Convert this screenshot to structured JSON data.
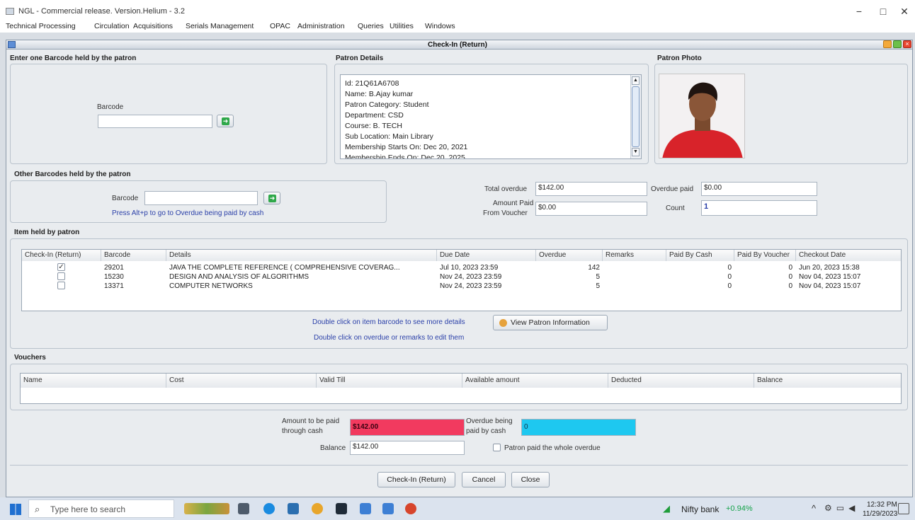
{
  "window": {
    "title": "NGL - Commercial release. Version.Helium - 3.2",
    "minimize": "−",
    "maximize": "□",
    "close": "✕"
  },
  "menu": [
    "Technical Processing",
    "Circulation",
    "Acquisitions",
    "Serials Management",
    "OPAC",
    "Administration",
    "Queries",
    "Utilities",
    "Windows"
  ],
  "frame": {
    "title": "Check-In (Return)"
  },
  "barcode_section": {
    "title": "Enter one Barcode held by the patron",
    "label": "Barcode",
    "value": ""
  },
  "patron_details": {
    "title": "Patron Details",
    "lines": [
      "Id: 21Q61A6708",
      "Name: B.Ajay kumar",
      "Patron Category: Student",
      "Department: CSD",
      "Course: B. TECH",
      "Sub Location: Main Library",
      "Membership Starts On: Dec 20, 2021",
      "Membership Ends On: Dec 20, 2025"
    ]
  },
  "patron_photo": {
    "title": "Patron Photo"
  },
  "other_barcodes": {
    "title": "Other Barcodes held by the patron",
    "label": "Barcode",
    "value": "",
    "hint": "Press Alt+p to go to Overdue being paid by cash"
  },
  "summary": {
    "total_overdue_label": "Total overdue",
    "total_overdue": "$142.00",
    "overdue_paid_label": "Overdue paid",
    "overdue_paid": "$0.00",
    "amount_voucher_label_1": "Amount Paid",
    "amount_voucher_label_2": "From Voucher",
    "amount_voucher": "$0.00",
    "count_label": "Count",
    "count": "1"
  },
  "items": {
    "title": "Item held by patron",
    "columns": [
      "Check-In (Return)",
      "Barcode",
      "Details",
      "Due Date",
      "Overdue",
      "Remarks",
      "Paid By Cash",
      "Paid By Voucher",
      "Checkout Date"
    ],
    "rows": [
      {
        "checked": true,
        "barcode": "29201",
        "details": "JAVA THE COMPLETE REFERENCE ( COMPREHENSIVE COVERAG...",
        "due": "Jul 10, 2023 23:59",
        "overdue": "142",
        "remarks": "",
        "cash": "0",
        "voucher": "0",
        "checkout": "Jun 20, 2023 15:38"
      },
      {
        "checked": false,
        "barcode": "15230",
        "details": "DESIGN AND ANALYSIS OF ALGORITHMS",
        "due": "Nov 24, 2023 23:59",
        "overdue": "5",
        "remarks": "",
        "cash": "0",
        "voucher": "0",
        "checkout": "Nov 04, 2023 15:07"
      },
      {
        "checked": false,
        "barcode": "13371",
        "details": "COMPUTER NETWORKS",
        "due": "Nov 24, 2023 23:59",
        "overdue": "5",
        "remarks": "",
        "cash": "0",
        "voucher": "0",
        "checkout": "Nov 04, 2023 15:07"
      }
    ],
    "hint1": "Double click on item barcode to see more details",
    "hint2": "Double click on overdue or remarks to edit them",
    "view_button": "View Patron Information"
  },
  "vouchers": {
    "title": "Vouchers",
    "columns": [
      "Name",
      "Cost",
      "Valid Till",
      "Available amount",
      "Deducted",
      "Balance"
    ]
  },
  "payment": {
    "cash_label_1": "Amount to be paid",
    "cash_label_2": "through cash",
    "cash_value": "$142.00",
    "overdue_label_1": "Overdue being",
    "overdue_label_2": "paid by cash",
    "overdue_value": "0",
    "balance_label": "Balance",
    "balance_value": "$142.00",
    "paid_whole_label": "Patron paid the whole overdue",
    "cash_color": "#f23a5f",
    "overdue_color": "#1ec8f0"
  },
  "buttons": {
    "checkin": "Check-In (Return)",
    "cancel": "Cancel",
    "close": "Close"
  },
  "taskbar": {
    "search_placeholder": "Type here to search",
    "ticker_name": "Nifty bank",
    "ticker_value": "+0.94%",
    "time": "12:32 PM",
    "date": "11/29/2023"
  }
}
